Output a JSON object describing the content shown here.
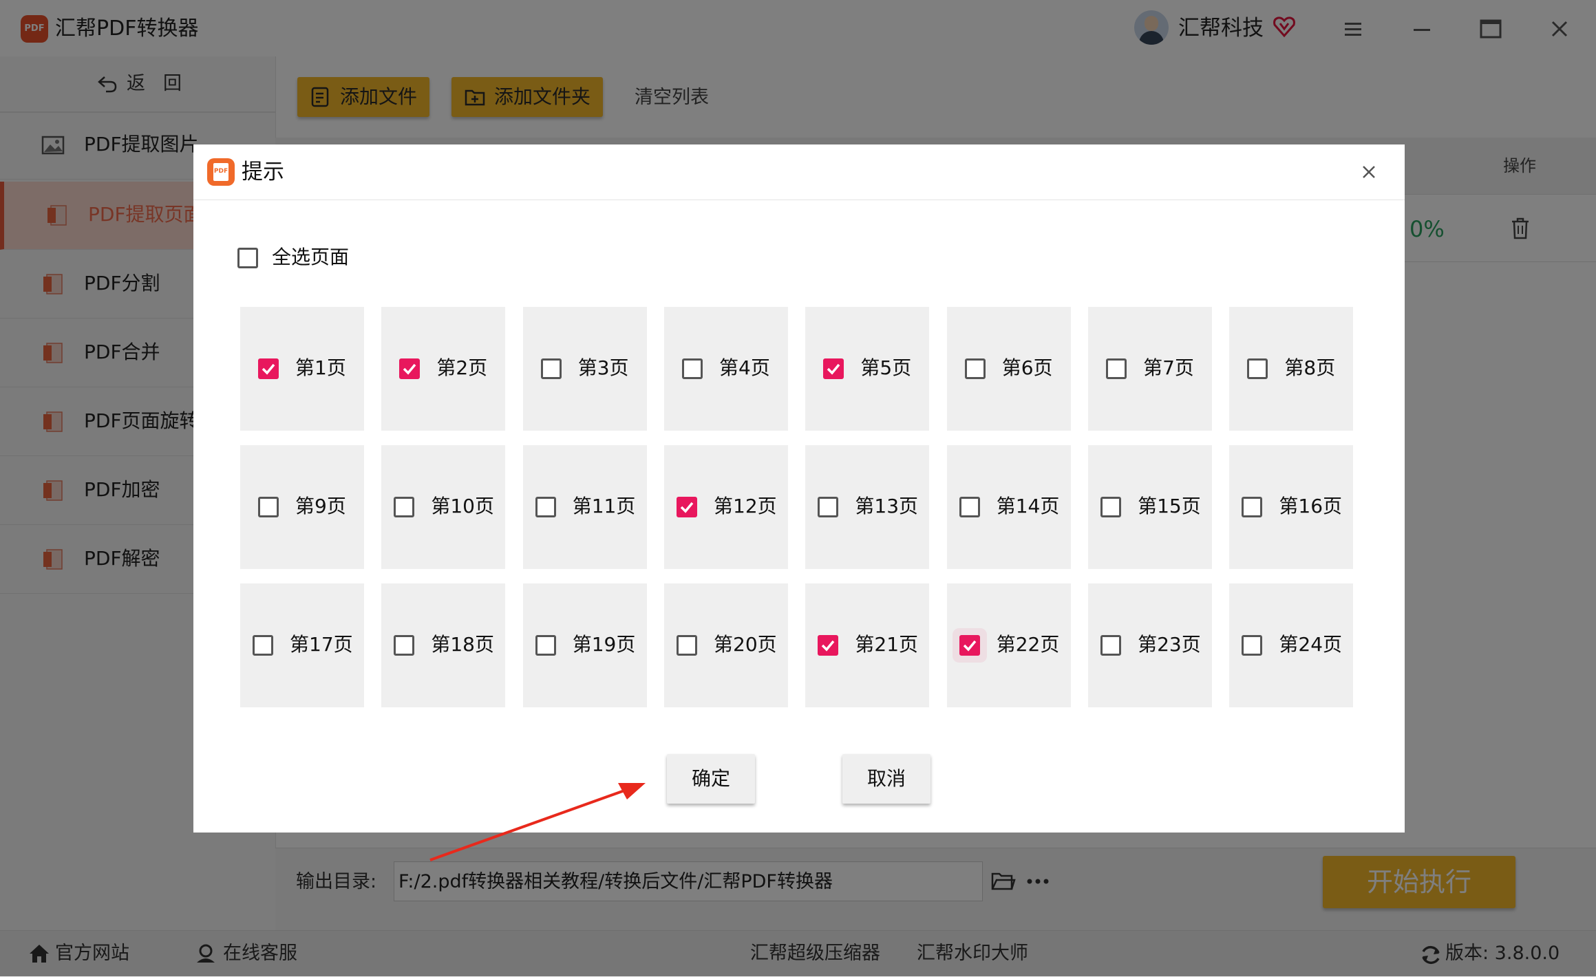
{
  "app": {
    "title": "汇帮PDF转换器",
    "logo_text": "PDF",
    "user_name": "汇帮科技"
  },
  "sidebar": {
    "back_label": "返回",
    "items": [
      {
        "label": "PDF提取图片",
        "icon": "image-icon",
        "active": false
      },
      {
        "label": "PDF提取页面",
        "icon": "pdf-file-icon",
        "active": true
      },
      {
        "label": "PDF分割",
        "icon": "pdf-file-icon",
        "active": false
      },
      {
        "label": "PDF合并",
        "icon": "pdf-file-icon",
        "active": false
      },
      {
        "label": "PDF页面旋转",
        "icon": "pdf-file-icon",
        "active": false
      },
      {
        "label": "PDF加密",
        "icon": "pdf-file-icon",
        "active": false
      },
      {
        "label": "PDF解密",
        "icon": "pdf-file-icon",
        "active": false
      }
    ]
  },
  "toolbar": {
    "add_file": "添加文件",
    "add_folder": "添加文件夹",
    "clear_list": "清空列表"
  },
  "table": {
    "col_operation": "操作",
    "row_progress": "0%"
  },
  "output": {
    "label": "输出目录:",
    "path": "F:/2.pdf转换器相关教程/转换后文件/汇帮PDF转换器"
  },
  "start_button": "开始执行",
  "footer": {
    "website": "官方网站",
    "support": "在线客服",
    "compressor": "汇帮超级压缩器",
    "watermark": "汇帮水印大师",
    "version": "版本: 3.8.0.0"
  },
  "dialog": {
    "title": "提示",
    "select_all_label": "全选页面",
    "select_all_checked": false,
    "pages": [
      {
        "label": "第1页",
        "checked": true
      },
      {
        "label": "第2页",
        "checked": true
      },
      {
        "label": "第3页",
        "checked": false
      },
      {
        "label": "第4页",
        "checked": false
      },
      {
        "label": "第5页",
        "checked": true
      },
      {
        "label": "第6页",
        "checked": false
      },
      {
        "label": "第7页",
        "checked": false
      },
      {
        "label": "第8页",
        "checked": false
      },
      {
        "label": "第9页",
        "checked": false
      },
      {
        "label": "第10页",
        "checked": false
      },
      {
        "label": "第11页",
        "checked": false
      },
      {
        "label": "第12页",
        "checked": true
      },
      {
        "label": "第13页",
        "checked": false
      },
      {
        "label": "第14页",
        "checked": false
      },
      {
        "label": "第15页",
        "checked": false
      },
      {
        "label": "第16页",
        "checked": false
      },
      {
        "label": "第17页",
        "checked": false
      },
      {
        "label": "第18页",
        "checked": false
      },
      {
        "label": "第19页",
        "checked": false
      },
      {
        "label": "第20页",
        "checked": false
      },
      {
        "label": "第21页",
        "checked": true
      },
      {
        "label": "第22页",
        "checked": true
      },
      {
        "label": "第23页",
        "checked": false
      },
      {
        "label": "第24页",
        "checked": false
      }
    ],
    "confirm_label": "确定",
    "cancel_label": "取消"
  },
  "colors": {
    "accent_yellow": "#f5b82b",
    "check_pink": "#e8175d",
    "active_orange": "#e95a3d",
    "progress_green": "#2aa060",
    "annotation_arrow": "#e8291c"
  }
}
